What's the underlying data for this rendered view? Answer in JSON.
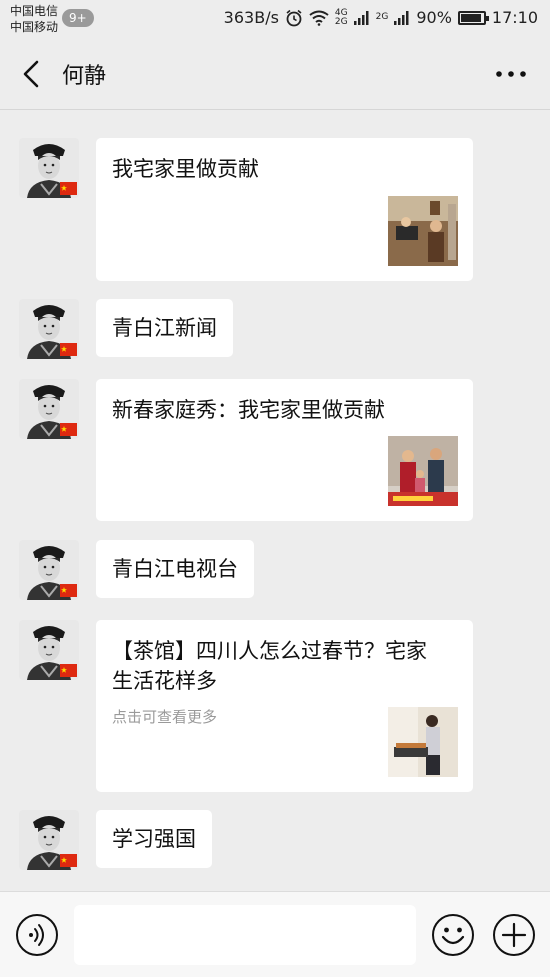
{
  "status_bar": {
    "carrier1": "中国电信",
    "carrier2": "中国移动",
    "notif_badge": "9+",
    "speed": "363B/s",
    "net1_top": "4G",
    "net1_bottom": "2G",
    "net2": "2G",
    "battery": "90%",
    "battery_level": 0.9,
    "time": "17:10"
  },
  "header": {
    "title": "何静"
  },
  "messages": [
    {
      "type": "card",
      "title": "我宅家里做贡献",
      "thumb_icon": "family-music-photo"
    },
    {
      "type": "text",
      "text": "青白江新闻"
    },
    {
      "type": "card",
      "title": "新春家庭秀：我宅家里做贡献",
      "thumb_icon": "family-video-photo"
    },
    {
      "type": "text",
      "text": "青白江电视台"
    },
    {
      "type": "card",
      "title": "【茶馆】四川人怎么过春节？宅家生活花样多",
      "desc": "点击可查看更多",
      "thumb_icon": "cooking-photo"
    },
    {
      "type": "text",
      "text": "学习强国"
    }
  ],
  "avatar": {
    "icon": "qing-dynasty-portrait-avatar",
    "flag": "china-flag"
  },
  "input_bar": {
    "placeholder": ""
  },
  "colors": {
    "background": "#ededed",
    "bubble": "#ffffff",
    "desc_text": "#9a9a9a"
  }
}
